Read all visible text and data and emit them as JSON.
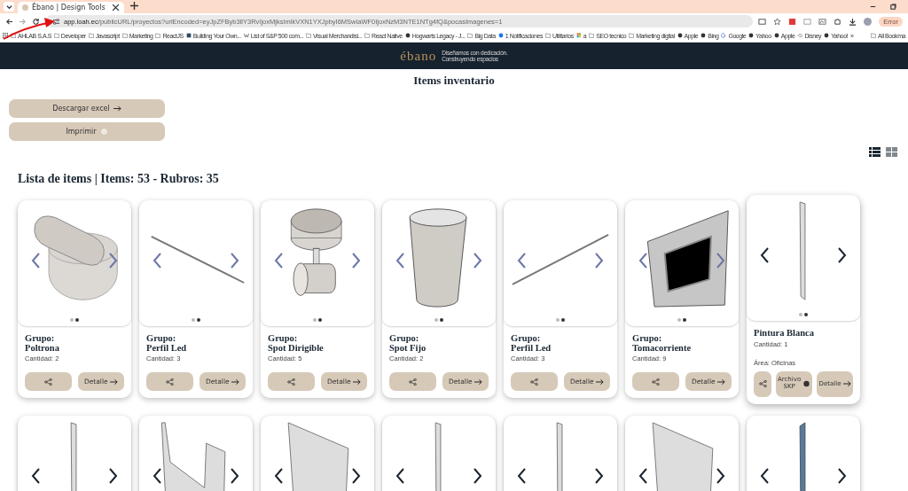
{
  "browser": {
    "tab_title": "Ébano | Design Tools",
    "url_host": "app.loah.ec",
    "url_path": "/publicURL/proyectos?urlEncoded=eyJpZFByb3llY3RvIjoxMjksImlkVXN1YXJpbyI6MSwiaWF0IjoxNzM3NTE1NTg4fQ&pocasImagenes=1",
    "profile_button": "Error",
    "bookmarks": [
      {
        "label": "AHLAB S.A.S",
        "kind": "folder"
      },
      {
        "label": "Developer",
        "kind": "folder"
      },
      {
        "label": "Javascript",
        "kind": "folder"
      },
      {
        "label": "Marketing",
        "kind": "folder"
      },
      {
        "label": "ReactJS",
        "kind": "folder"
      },
      {
        "label": "Building Your Own...",
        "kind": "square"
      },
      {
        "label": "List of S&P 500 com...",
        "kind": "w"
      },
      {
        "label": "Visual Merchandisi...",
        "kind": "folder"
      },
      {
        "label": "React Native",
        "kind": "folder"
      },
      {
        "label": "Hogwarts Legacy - J...",
        "kind": "globe"
      },
      {
        "label": "Big Data",
        "kind": "folder"
      },
      {
        "label": "1 Notificaciones",
        "kind": "facebook"
      },
      {
        "label": "Utilitarios",
        "kind": "folder"
      },
      {
        "label": "a",
        "kind": "tiles"
      },
      {
        "label": "SEO tecnico",
        "kind": "folder"
      },
      {
        "label": "Marketing digital",
        "kind": "folder"
      },
      {
        "label": "Apple",
        "kind": "globe"
      },
      {
        "label": "Bing",
        "kind": "globe"
      },
      {
        "label": "Google",
        "kind": "google"
      },
      {
        "label": "Yahoo",
        "kind": "globe"
      },
      {
        "label": "Apple",
        "kind": "globe"
      },
      {
        "label": "Disney",
        "kind": "swirl"
      },
      {
        "label": "Yahoo!",
        "kind": "globe"
      }
    ],
    "more_bookmarks": "»",
    "all_bookmarks": "All Bookma"
  },
  "header": {
    "logo": "ébano",
    "tagline_1": "Diseñamos con dedicación.",
    "tagline_2": "Construyendo espacios"
  },
  "page_title": "Items inventario",
  "actions": [
    {
      "label": "Descargar excel",
      "kind": "arrow"
    },
    {
      "label": "Imprimir",
      "kind": "print"
    }
  ],
  "view_toggle": [
    {
      "kind": "list",
      "selected": true
    },
    {
      "kind": "grid",
      "selected": false
    }
  ],
  "list_heading": "Lista de items | Items: 53 - Rubros: 35",
  "cards": [
    {
      "kind": "armchair",
      "highlighted": false,
      "group_label": "Grupo:",
      "name": "Poltrona",
      "quantity": "Cantidad: 2",
      "buttons": [
        {
          "kind": "share"
        },
        {
          "kind": "detail",
          "label": "Detalle"
        }
      ],
      "dots": [
        {
          "selected": false
        },
        {
          "selected": true
        }
      ]
    },
    {
      "kind": "rod_down",
      "highlighted": false,
      "group_label": "Grupo:",
      "name": "Perfil Led",
      "quantity": "Cantidad: 3",
      "buttons": [
        {
          "kind": "share"
        },
        {
          "kind": "detail",
          "label": "Detalle"
        }
      ],
      "dots": [
        {
          "selected": false
        },
        {
          "selected": true
        }
      ]
    },
    {
      "kind": "spot",
      "highlighted": false,
      "group_label": "Grupo:",
      "name": "Spot Dirigible",
      "quantity": "Cantidad: 5",
      "buttons": [
        {
          "kind": "share"
        },
        {
          "kind": "detail",
          "label": "Detalle"
        }
      ],
      "dots": [
        {
          "selected": false
        },
        {
          "selected": true
        }
      ]
    },
    {
      "kind": "cylinder",
      "highlighted": false,
      "group_label": "Grupo:",
      "name": "Spot Fijo",
      "quantity": "Cantidad: 2",
      "buttons": [
        {
          "kind": "share"
        },
        {
          "kind": "detail",
          "label": "Detalle"
        }
      ],
      "dots": [
        {
          "selected": false
        },
        {
          "selected": true
        }
      ]
    },
    {
      "kind": "rod_up",
      "highlighted": false,
      "group_label": "Grupo:",
      "name": "Perfil Led",
      "quantity": "Cantidad: 3",
      "buttons": [
        {
          "kind": "share"
        },
        {
          "kind": "detail",
          "label": "Detalle"
        }
      ],
      "dots": [
        {
          "selected": false
        },
        {
          "selected": true
        }
      ]
    },
    {
      "kind": "socket",
      "highlighted": false,
      "group_label": "Grupo:",
      "name": "Tomacorriente",
      "quantity": "Cantidad: 9",
      "buttons": [
        {
          "kind": "share"
        },
        {
          "kind": "detail",
          "label": "Detalle"
        }
      ],
      "dots": [
        {
          "selected": false
        },
        {
          "selected": true
        }
      ]
    },
    {
      "kind": "strip",
      "highlighted": true,
      "name": "Pintura Blanca",
      "quantity": "Cantidad: 1",
      "area": "Área: Oficinas",
      "buttons": [
        {
          "kind": "share"
        },
        {
          "kind": "file",
          "label": "Archivo SKP"
        },
        {
          "kind": "detail",
          "label": "Detalle"
        }
      ],
      "dots": [
        {
          "selected": false
        },
        {
          "selected": true
        }
      ]
    }
  ],
  "more_cards": [
    {
      "kind": "strip"
    },
    {
      "kind": "bent"
    },
    {
      "kind": "slab"
    },
    {
      "kind": "strip"
    },
    {
      "kind": "strip"
    },
    {
      "kind": "slab"
    },
    {
      "kind": "blue_strip"
    }
  ]
}
